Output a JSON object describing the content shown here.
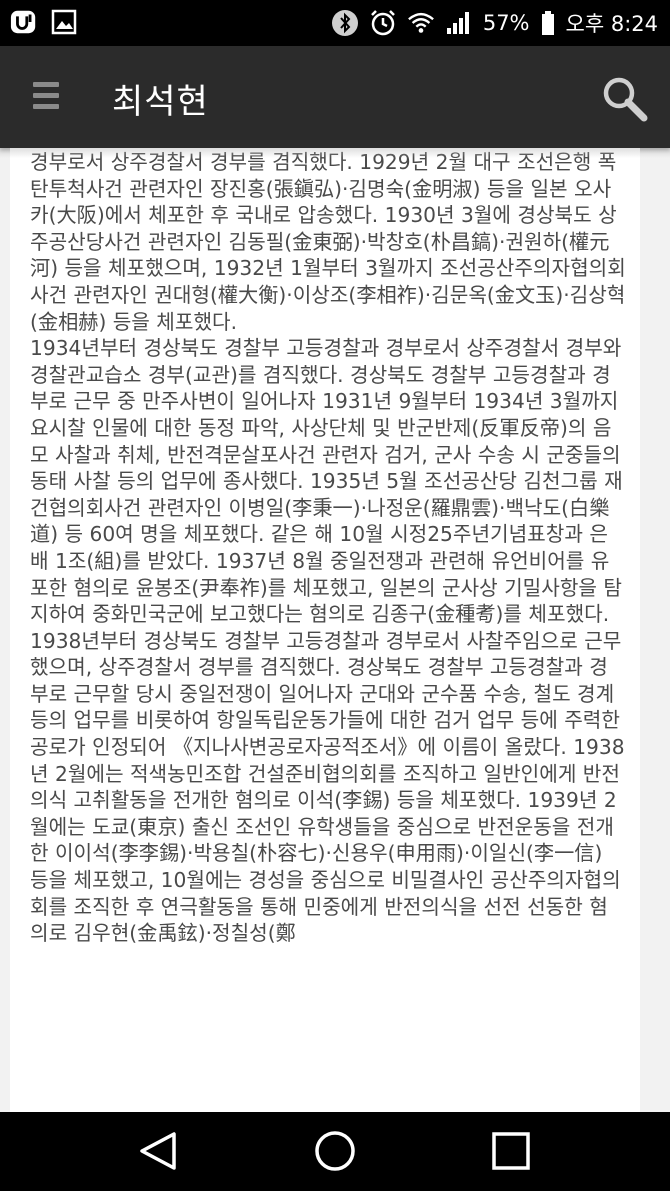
{
  "status_bar": {
    "battery_percent": "57%",
    "time": "오후 8:24",
    "icons": [
      "uplus-icon",
      "image-icon",
      "bluetooth-icon",
      "alarm-icon",
      "wifi-icon",
      "signal-icon",
      "battery-icon"
    ]
  },
  "app_bar": {
    "title": "최석현",
    "menu_icon": "hamburger-menu-icon",
    "search_icon": "search-icon"
  },
  "content": {
    "paragraphs": [
      "경부로서 상주경찰서 경부를 겸직했다. 1929년 2월 대구 조선은행 폭탄투척사건 관련자인 장진홍(張鎭弘)·김명숙(金明淑) 등을 일본 오사카(大阪)에서 체포한 후 국내로 압송했다. 1930년 3월에 경상북도 상주공산당사건 관련자인 김동필(金東弼)·박창호(朴昌鎬)·권원하(權元河) 등을 체포했으며, 1932년 1월부터 3월까지 조선공산주의자협의회사건 관련자인 권대형(權大衡)·이상조(李相祚)·김문옥(金文玉)·김상혁(金相赫) 등을 체포했다.",
      "1934년부터 경상북도 경찰부 고등경찰과 경부로서 상주경찰서 경부와 경찰관교습소 경부(교관)를 겸직했다. 경상북도 경찰부 고등경찰과 경부로 근무 중 만주사변이 일어나자 1931년 9월부터 1934년 3월까지 요시찰 인물에 대한 동정 파악, 사상단체 및 반군반제(反軍反帝)의 음모 사찰과 취체, 반전격문살포사건 관련자 검거, 군사 수송 시 군중들의 동태 사찰 등의 업무에 종사했다. 1935년 5월 조선공산당 김천그룹 재건협의회사건 관련자인 이병일(李秉一)·나정운(羅鼎雲)·백낙도(白樂道) 등 60여 명을 체포했다. 같은 해 10월 시정25주년기념표창과 은배 1조(組)를 받았다. 1937년 8월 중일전쟁과 관련해 유언비어를 유포한 혐의로 윤봉조(尹奉祚)를 체포했고, 일본의 군사상 기밀사항을 탐지하여 중화민국군에 보고했다는 혐의로 김종구(金種耉)를 체포했다.",
      "1938년부터 경상북도 경찰부 고등경찰과 경부로서 사찰주임으로 근무했으며, 상주경찰서 경부를 겸직했다. 경상북도 경찰부 고등경찰과 경부로 근무할 당시 중일전쟁이 일어나자 군대와 군수품 수송, 철도 경계 등의 업무를 비롯하여 항일독립운동가들에 대한 검거 업무 등에 주력한 공로가 인정되어 《지나사변공로자공적조서》에 이름이 올랐다. 1938년 2월에는 적색농민조합 건설준비협의회를 조직하고 일반인에게 반전의식 고취활동을 전개한 혐의로 이석(李錫) 등을 체포했다. 1939년 2월에는 도쿄(東京) 출신 조선인 유학생들을 중심으로 반전운동을 전개한 이이석(李李錫)·박용칠(朴容七)·신용우(申用雨)·이일신(李一信) 등을 체포했고, 10월에는 경성을 중심으로 비밀결사인 공산주의자협의회를 조직한 후 연극활동을 통해 민중에게 반전의식을 선전 선동한 혐의로 김우현(金禹鉉)·정칠성(鄭"
    ]
  },
  "nav_bar": {
    "buttons": [
      "back-icon",
      "home-icon",
      "recents-icon"
    ]
  }
}
